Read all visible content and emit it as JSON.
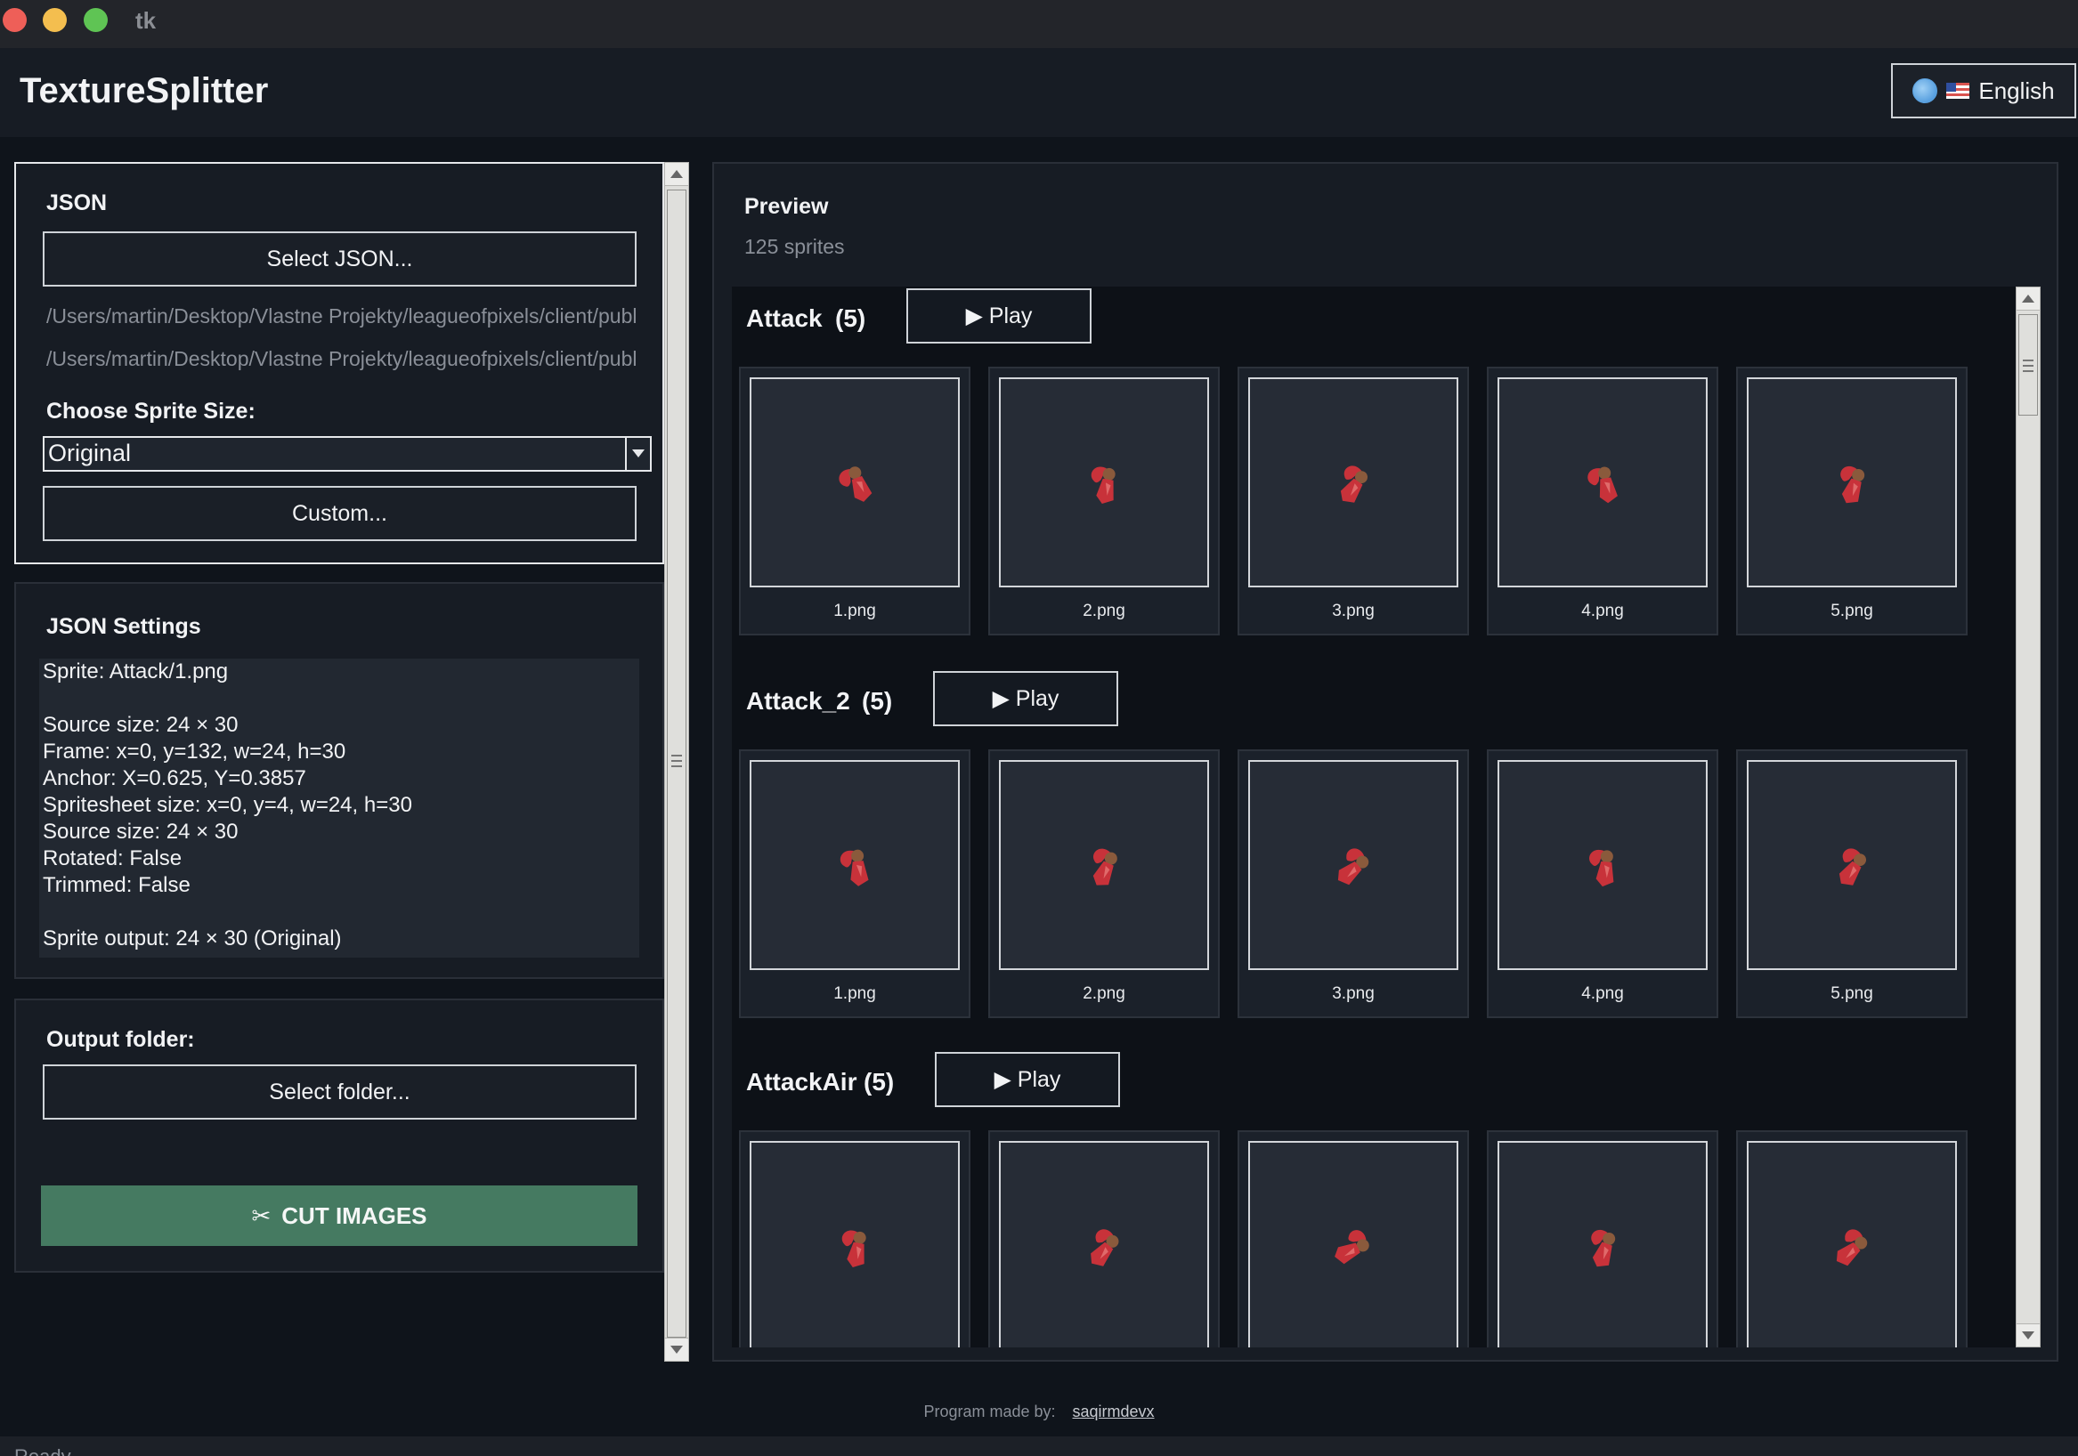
{
  "window": {
    "title": "tk"
  },
  "header": {
    "app_name": "TextureSplitter",
    "language_label": "English"
  },
  "json_panel": {
    "title": "JSON",
    "select_json_label": "Select JSON...",
    "paths": [
      "/Users/martin/Desktop/Vlastne Projekty/leagueofpixels/client/public",
      "/Users/martin/Desktop/Vlastne Projekty/leagueofpixels/client/public"
    ],
    "sprite_size_label": "Choose Sprite Size:",
    "sprite_size_value": "Original",
    "custom_label": "Custom..."
  },
  "settings_panel": {
    "title": "JSON Settings",
    "text": "Sprite: Attack/1.png\n\nSource size: 24 × 30\nFrame: x=0, y=132, w=24, h=30\nAnchor: X=0.625, Y=0.3857\nSpritesheet size: x=0, y=4, w=24, h=30\nSource size: 24 × 30\nRotated: False\nTrimmed: False\n\nSprite output: 24 × 30 (Original)"
  },
  "output_panel": {
    "title": "Output folder:",
    "select_folder_label": "Select folder...",
    "cut_label": "CUT IMAGES",
    "cut_color": "#457a61"
  },
  "preview": {
    "title": "Preview",
    "count": "125 sprites",
    "play_label": "▶ Play",
    "groups": [
      {
        "name": "Attack",
        "count": "(5)",
        "frames": [
          "1.png",
          "2.png",
          "3.png",
          "4.png",
          "5.png"
        ]
      },
      {
        "name": "Attack_2",
        "count": "(5)",
        "frames": [
          "1.png",
          "2.png",
          "3.png",
          "4.png",
          "5.png"
        ]
      },
      {
        "name": "AttackAir",
        "count": "(5)",
        "frames": [
          "",
          "",
          "",
          "",
          ""
        ]
      }
    ]
  },
  "footer": {
    "made_by": "Program made by:",
    "author": "saqirmdevx"
  },
  "status": {
    "text": "Ready"
  },
  "colors": {
    "sprite_red": "#c8323a",
    "sprite_hair": "#8a5a3c",
    "background": "#0f141b"
  }
}
